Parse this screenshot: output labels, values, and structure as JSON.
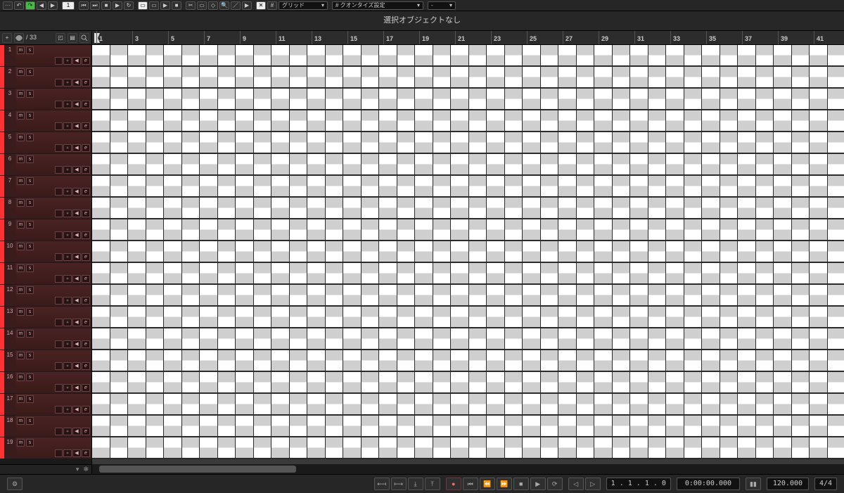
{
  "infoline": {
    "text": "選択オブジェクトなし"
  },
  "toolbar": {
    "history": "···",
    "field1": "1",
    "snap_label": "グリッド",
    "quant_label": "# クオンタイズ設定",
    "dummy": "-"
  },
  "trackHeader": {
    "plus": "+",
    "count": "/ 33"
  },
  "trackBtns": {
    "m": "m",
    "s": "s",
    "rec": "●",
    "mon": "◀",
    "e": "e"
  },
  "tracks": [
    {
      "num": "1"
    },
    {
      "num": "2"
    },
    {
      "num": "3"
    },
    {
      "num": "4"
    },
    {
      "num": "5"
    },
    {
      "num": "6"
    },
    {
      "num": "7"
    },
    {
      "num": "8"
    },
    {
      "num": "9"
    },
    {
      "num": "10"
    },
    {
      "num": "11"
    },
    {
      "num": "12"
    },
    {
      "num": "13"
    },
    {
      "num": "14"
    },
    {
      "num": "15"
    },
    {
      "num": "16"
    },
    {
      "num": "17"
    },
    {
      "num": "18"
    },
    {
      "num": "19"
    }
  ],
  "ruler": {
    "bars": [
      "1",
      "3",
      "5",
      "7",
      "9",
      "11",
      "13",
      "15",
      "17",
      "19",
      "21",
      "23",
      "25",
      "27",
      "29",
      "31",
      "33",
      "35",
      "37",
      "39",
      "41"
    ]
  },
  "grid": {
    "cols": 42,
    "cellWidth": 25.5
  },
  "transport": {
    "loc": "1 . 1 . 1 . 0",
    "time": "0:00:00.000",
    "tempo": "120.000",
    "sig": "4/4"
  },
  "trackFoot": {
    "down": "▾",
    "gear": "✻"
  }
}
